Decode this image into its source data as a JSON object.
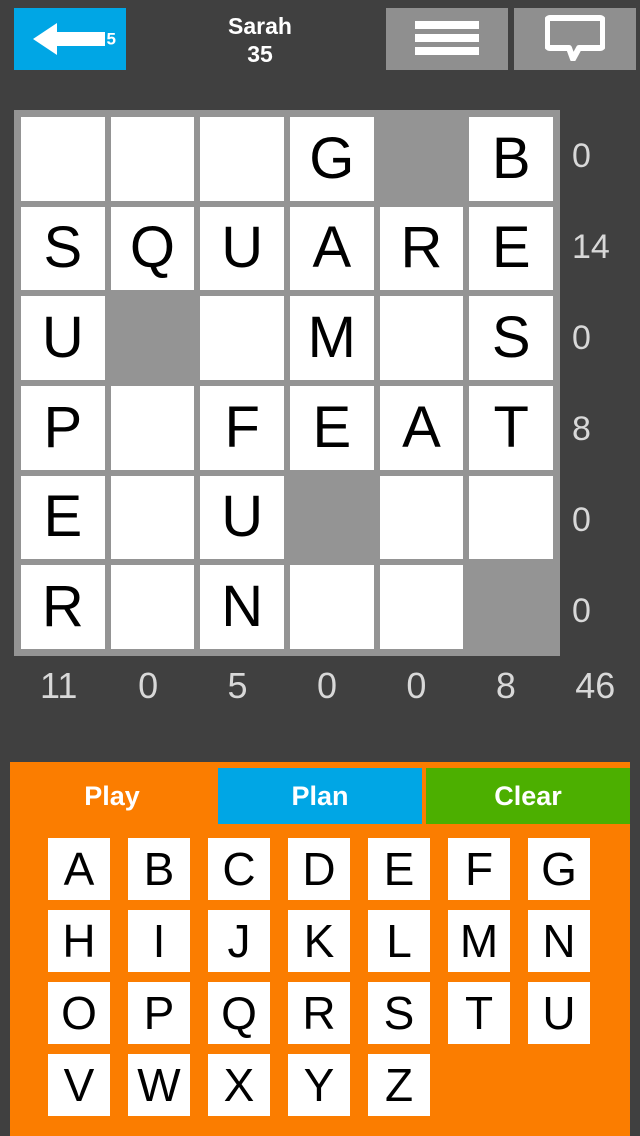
{
  "header": {
    "back_button": {
      "icon": "left-arrow-icon",
      "badge": "5",
      "color": "#00a6e5"
    },
    "player": {
      "name": "Sarah",
      "score": "35"
    },
    "menu_button": {
      "icon": "hamburger-menu-icon"
    },
    "chat_button": {
      "icon": "chat-bubble-icon"
    }
  },
  "board": {
    "rows": 6,
    "cols": 6,
    "cells": [
      [
        "",
        "",
        "",
        "G",
        null,
        "B"
      ],
      [
        "S",
        "Q",
        "U",
        "A",
        "R",
        "E"
      ],
      [
        "U",
        null,
        "",
        "M",
        "",
        "S"
      ],
      [
        "P",
        "",
        "F",
        "E",
        "A",
        "T"
      ],
      [
        "E",
        "",
        "U",
        null,
        "",
        ""
      ],
      [
        "R",
        "",
        "N",
        "",
        "",
        null
      ]
    ],
    "row_scores": [
      "0",
      "14",
      "0",
      "8",
      "0",
      "0"
    ],
    "col_scores": [
      "11",
      "0",
      "5",
      "0",
      "0",
      "8"
    ],
    "total_score": "46"
  },
  "actions": {
    "play_label": "Play",
    "plan_label": "Plan",
    "clear_label": "Clear",
    "play_color": "#fb7d00",
    "plan_color": "#00a6e5",
    "clear_color": "#4caf00"
  },
  "keyboard": {
    "rows": [
      [
        "A",
        "B",
        "C",
        "D",
        "E",
        "F",
        "G"
      ],
      [
        "H",
        "I",
        "J",
        "K",
        "L",
        "M",
        "N"
      ],
      [
        "O",
        "P",
        "Q",
        "R",
        "S",
        "T",
        "U"
      ],
      [
        "V",
        "W",
        "X",
        "Y",
        "Z"
      ]
    ]
  },
  "colors": {
    "background": "#404040",
    "grid_frame": "#949494",
    "blocked_cell": "#949494",
    "cell": "#ffffff",
    "panel": "#fb7d00",
    "score_text": "#d8d8d8"
  }
}
